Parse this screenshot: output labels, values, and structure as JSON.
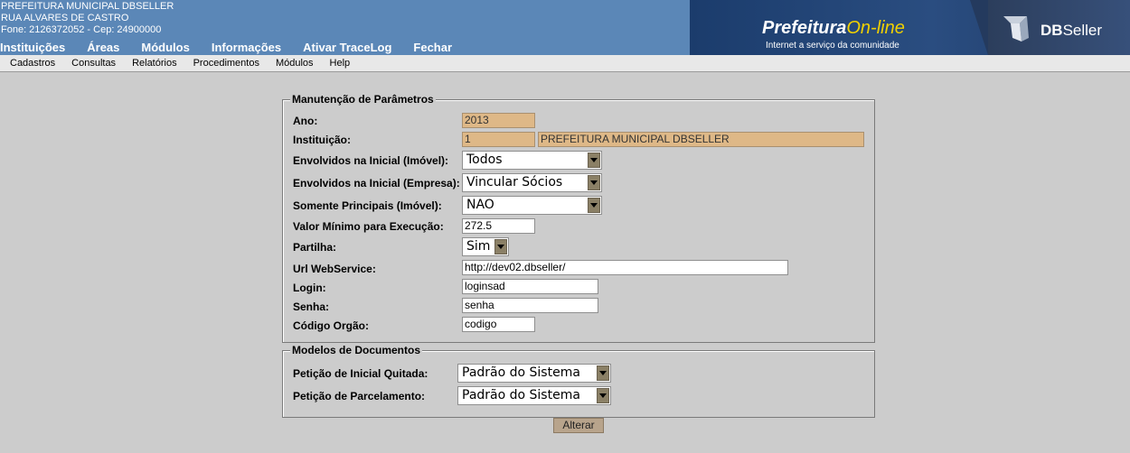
{
  "header": {
    "org_name": "PREFEITURA MUNICIPAL DBSELLER",
    "address": "RUA ALVARES DE CASTRO",
    "contact": "Fone: 2126372052  -  Cep: 24900000",
    "main_menu": [
      "Instituições",
      "Áreas",
      "Módulos",
      "Informações",
      "Ativar TraceLog",
      "Fechar"
    ],
    "banner": {
      "brand_prefix": "Prefeitura",
      "brand_suffix": "On-line",
      "tagline": "Internet a serviço da comunidade",
      "company_bold": "DB",
      "company_rest": "Seller"
    }
  },
  "sub_menu": [
    "Cadastros",
    "Consultas",
    "Relatórios",
    "Procedimentos",
    "Módulos",
    "Help"
  ],
  "parametros": {
    "legend": "Manutenção de Parâmetros",
    "ano_label": "Ano:",
    "ano_value": "2013",
    "instituicao_label": "Instituição:",
    "instituicao_code": "1",
    "instituicao_name": "PREFEITURA MUNICIPAL DBSELLER",
    "envolvidos_imovel_label": "Envolvidos na Inicial (Imóvel):",
    "envolvidos_imovel_value": "Todos",
    "envolvidos_empresa_label": "Envolvidos na Inicial (Empresa):",
    "envolvidos_empresa_value": "Vincular Sócios",
    "somente_principais_label": "Somente Principais (Imóvel):",
    "somente_principais_value": "NAO",
    "valor_minimo_label": "Valor Mínimo para Execução:",
    "valor_minimo_value": "272.5",
    "partilha_label": "Partilha:",
    "partilha_value": "Sim",
    "url_label": "Url WebService:",
    "url_value": "http://dev02.dbseller/",
    "login_label": "Login:",
    "login_value": "loginsad",
    "senha_label": "Senha:",
    "senha_value": "senha",
    "codigo_label": "Código Orgão:",
    "codigo_value": "codigo"
  },
  "modelos": {
    "legend": "Modelos de Documentos",
    "quitada_label": "Petição de Inicial Quitada:",
    "quitada_value": "Padrão do Sistema",
    "parcelamento_label": "Petição de Parcelamento:",
    "parcelamento_value": "Padrão do Sistema"
  },
  "alterar_button": "Alterar",
  "colors": {
    "header_bg": "#5b87b7",
    "readonly_bg": "#deb887",
    "page_bg": "#cccccc",
    "button_bg": "#b8a48c"
  }
}
